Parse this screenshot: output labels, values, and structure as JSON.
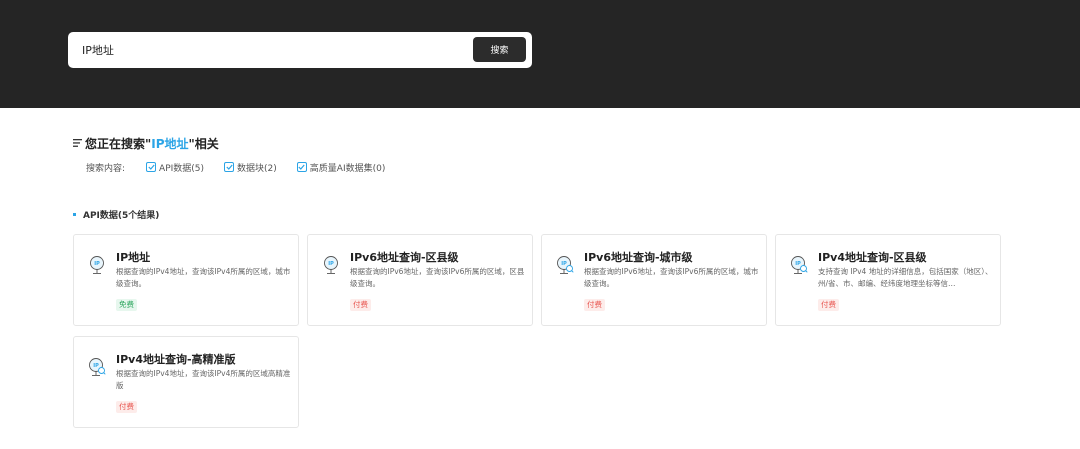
{
  "search": {
    "value": "IP地址",
    "button_label": "搜索"
  },
  "results": {
    "prefix": "您正在搜索\"",
    "keyword": "IP地址",
    "suffix": "\"相关",
    "filter_label": "搜索内容:",
    "filters": [
      {
        "label": "API数据(5)",
        "checked": true
      },
      {
        "label": "数据块(2)",
        "checked": true
      },
      {
        "label": "高质量AI数据集(0)",
        "checked": true
      }
    ]
  },
  "api_section": {
    "title": "API数据(5个结果)"
  },
  "cards": [
    {
      "title": "IP地址",
      "desc": "根据查询的IPv4地址，查询该IPv4所属的区域，城市级查询。",
      "badge": "免费",
      "icon": "ip-pin-icon"
    },
    {
      "title": "IPv6地址查询-区县级",
      "desc": "根据查询的IPv6地址，查询该IPv6所属的区域，区县级查询。",
      "badge": "付费",
      "icon": "ip-pin-icon"
    },
    {
      "title": "IPv6地址查询-城市级",
      "desc": "根据查询的IPv6地址，查询该IPv6所属的区域，城市级查询。",
      "badge": "付费",
      "icon": "ip-pin-search-icon"
    },
    {
      "title": "IPv4地址查询-区县级",
      "desc": "支持查询 IPv4 地址的详细信息，包括国家（地区）、州/省、市、邮编、经纬度地理坐标等信…",
      "badge": "付费",
      "icon": "ip-pin-search-icon"
    },
    {
      "title": "IPv4地址查询-高精准版",
      "desc": "根据查询的IPv4地址，查询该IPv4所属的区域高精准版",
      "badge": "付费",
      "icon": "ip-pin-search-icon"
    }
  ],
  "colors": {
    "header_bg": "#252525",
    "accent": "#2ba4e6",
    "free": "#2aa55c",
    "paid": "#e8554f"
  }
}
